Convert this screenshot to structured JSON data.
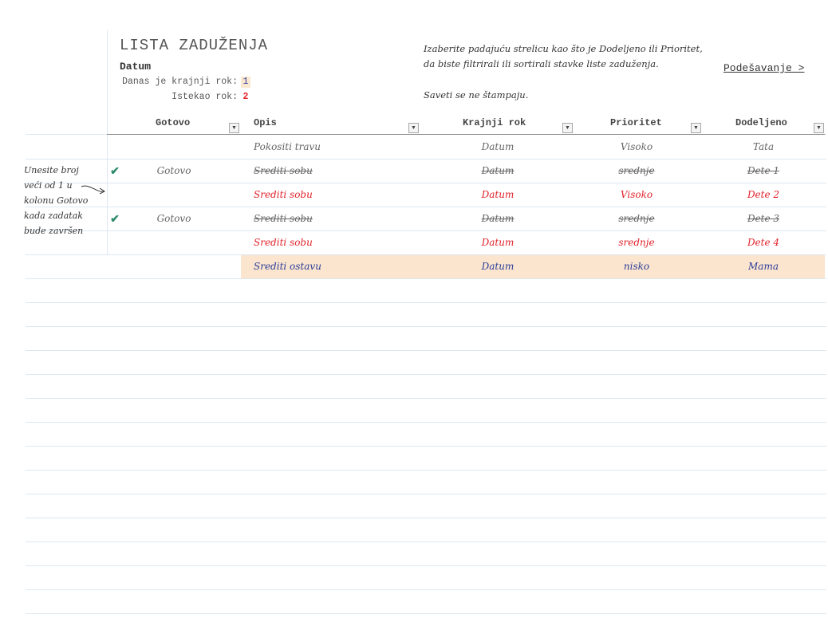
{
  "header": {
    "title": "LISTA ZADUŽENJA",
    "subtitle": "Datum",
    "today_label": "Danas je krajnji rok:",
    "today_value": "1",
    "overdue_label": "Istekao rok:",
    "overdue_value": "2"
  },
  "tips": {
    "line1": "Izaberite padajuću strelicu kao što je Dodeljeno ili Prioritet,",
    "line2": "da biste filtrirali ili sortirali stavke liste zaduženja.",
    "line3": "Saveti se ne štampaju."
  },
  "settings_link": "Podešavanje >",
  "side_note": [
    "Unesite broj",
    "veći od 1 u",
    "kolonu Gotovo",
    "kada zadatak",
    "bude završen"
  ],
  "columns": {
    "done": "Gotovo",
    "desc": "Opis",
    "due": "Krajnji rok",
    "priority": "Prioritet",
    "assigned": "Dodeljeno"
  },
  "dropdown_glyph": "▼",
  "rows": [
    {
      "check": "",
      "done": "",
      "desc": "Pokositi travu",
      "due": "Datum",
      "priority": "Visoko",
      "assigned": "Tata",
      "state": "normal"
    },
    {
      "check": "✔",
      "done": "Gotovo",
      "desc": "Srediti sobu",
      "due": "Datum",
      "priority": "srednje",
      "assigned": "Dete 1",
      "state": "done"
    },
    {
      "check": "",
      "done": "",
      "desc": "Srediti sobu",
      "due": "Datum",
      "priority": "Visoko",
      "assigned": "Dete 2",
      "state": "overdue"
    },
    {
      "check": "✔",
      "done": "Gotovo",
      "desc": "Srediti sobu",
      "due": "Datum",
      "priority": "srednje",
      "assigned": "Dete 3",
      "state": "done"
    },
    {
      "check": "",
      "done": "",
      "desc": "Srediti sobu",
      "due": "Datum",
      "priority": "srednje",
      "assigned": "Dete 4",
      "state": "overdue"
    },
    {
      "check": "",
      "done": "",
      "desc": "Srediti ostavu",
      "due": "Datum",
      "priority": "nisko",
      "assigned": "Mama",
      "state": "today"
    }
  ],
  "colors": {
    "overdue": "#e1222a",
    "today": "#2c3e9a",
    "today_highlight": "#fbe5cf",
    "check": "#2e8b6b"
  }
}
